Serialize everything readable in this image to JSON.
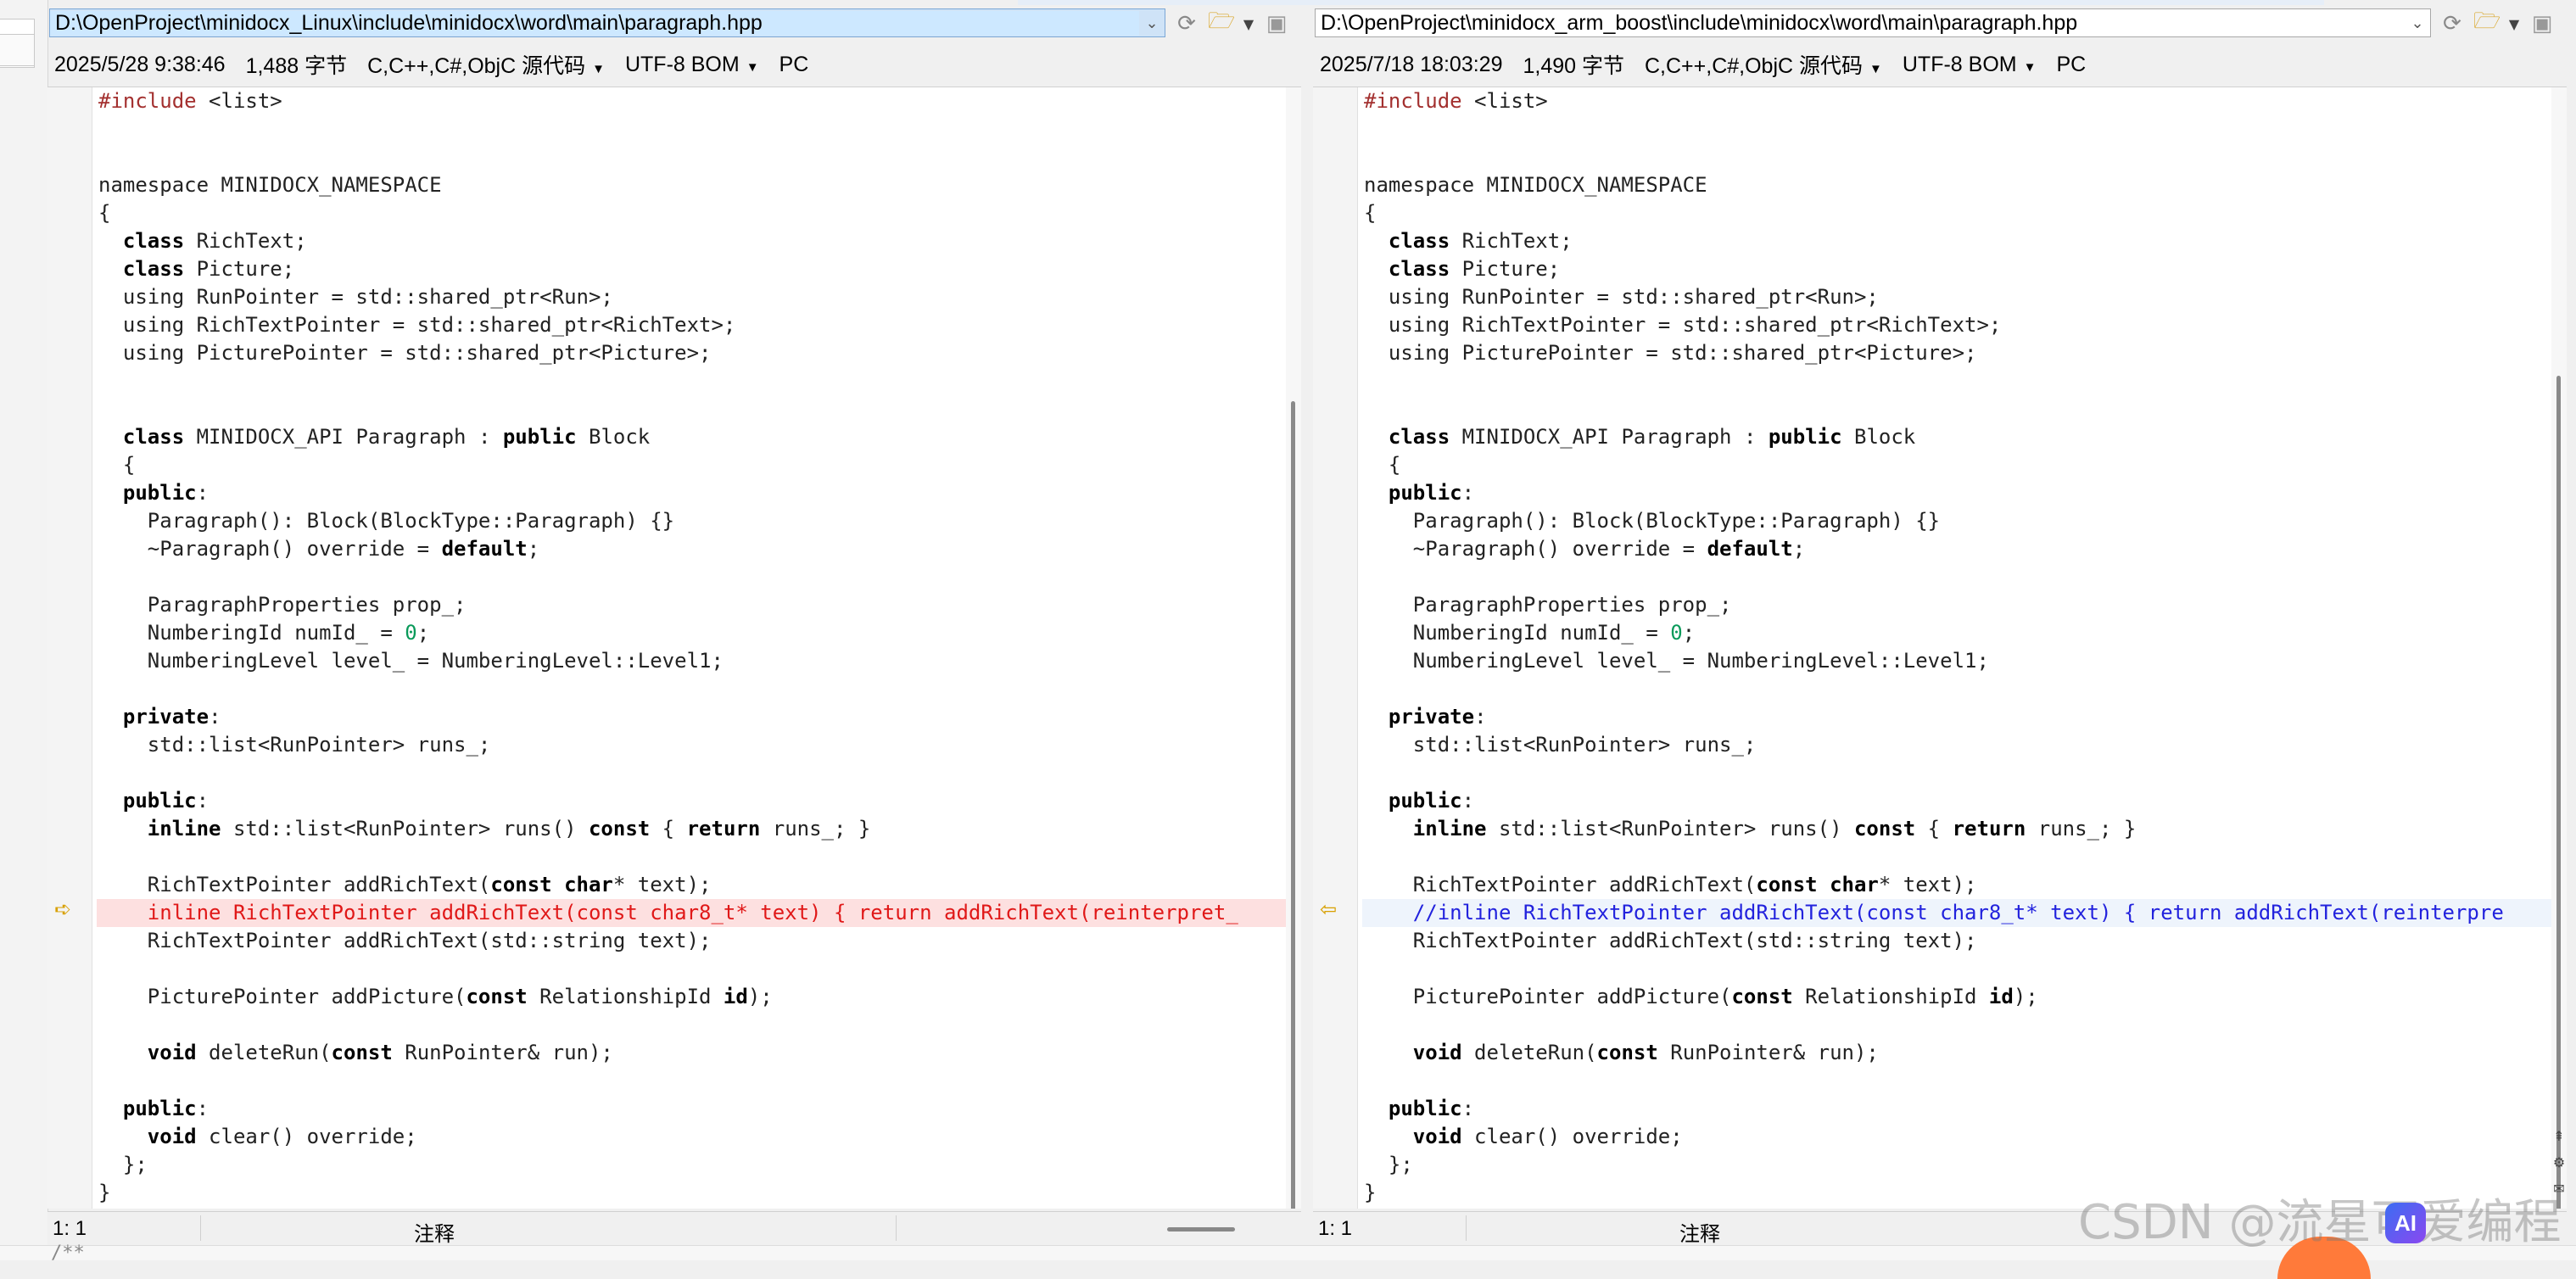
{
  "left": {
    "path": "D:\\OpenProject\\minidocx_Linux\\include\\minidocx\\word\\main\\paragraph.hpp",
    "info": {
      "datetime": "2025/5/28 9:38:46",
      "size": "1,488 字节",
      "language": "C,C++,C#,ObjC 源代码",
      "encoding": "UTF-8 BOM",
      "lineending": "PC"
    },
    "status": {
      "position": "1: 1",
      "mode": "注释"
    },
    "diff_line": "inline RichTextPointer addRichText(const char8_t* text) { return addRichText(reinterpret_"
  },
  "right": {
    "path": "D:\\OpenProject\\minidocx_arm_boost\\include\\minidocx\\word\\main\\paragraph.hpp",
    "info": {
      "datetime": "2025/7/18 18:03:29",
      "size": "1,490 字节",
      "language": "C,C++,C#,ObjC 源代码",
      "encoding": "UTF-8 BOM",
      "lineending": "PC"
    },
    "status": {
      "position": "1: 1",
      "mode": "注释"
    },
    "diff_line": "//inline RichTextPointer addRichText(const char8_t* text) { return addRichText(reinterpre"
  },
  "code": [
    "#include <list>",
    "",
    "",
    "namespace MINIDOCX_NAMESPACE",
    "{",
    "  class RichText;",
    "  class Picture;",
    "  using RunPointer = std::shared_ptr<Run>;",
    "  using RichTextPointer = std::shared_ptr<RichText>;",
    "  using PicturePointer = std::shared_ptr<Picture>;",
    "",
    "",
    "  class MINIDOCX_API Paragraph : public Block",
    "  {",
    "  public:",
    "    Paragraph(): Block(BlockType::Paragraph) {}",
    "    ~Paragraph() override = default;",
    "",
    "    ParagraphProperties prop_;",
    "    NumberingId numId_ = 0;",
    "    NumberingLevel level_ = NumberingLevel::Level1;",
    "",
    "  private:",
    "    std::list<RunPointer> runs_;",
    "",
    "  public:",
    "    inline std::list<RunPointer> runs() const { return runs_; }",
    "",
    "    RichTextPointer addRichText(const char* text);",
    "",
    "    RichTextPointer addRichText(std::string text);",
    "",
    "    PicturePointer addPicture(const RelationshipId id);",
    "",
    "    void deleteRun(const RunPointer& run);",
    "",
    "  public:",
    "    void clear() override;",
    "  };",
    "}"
  ],
  "toolbar": {
    "drop": "⌄",
    "folder_icon": "folder-open-icon",
    "save_icon": "save-icon",
    "refresh_icon": "refresh-icon"
  },
  "watermark": "CSDN @流星可爱编程",
  "ai_badge": "AI",
  "bottom_snippet": "/**"
}
